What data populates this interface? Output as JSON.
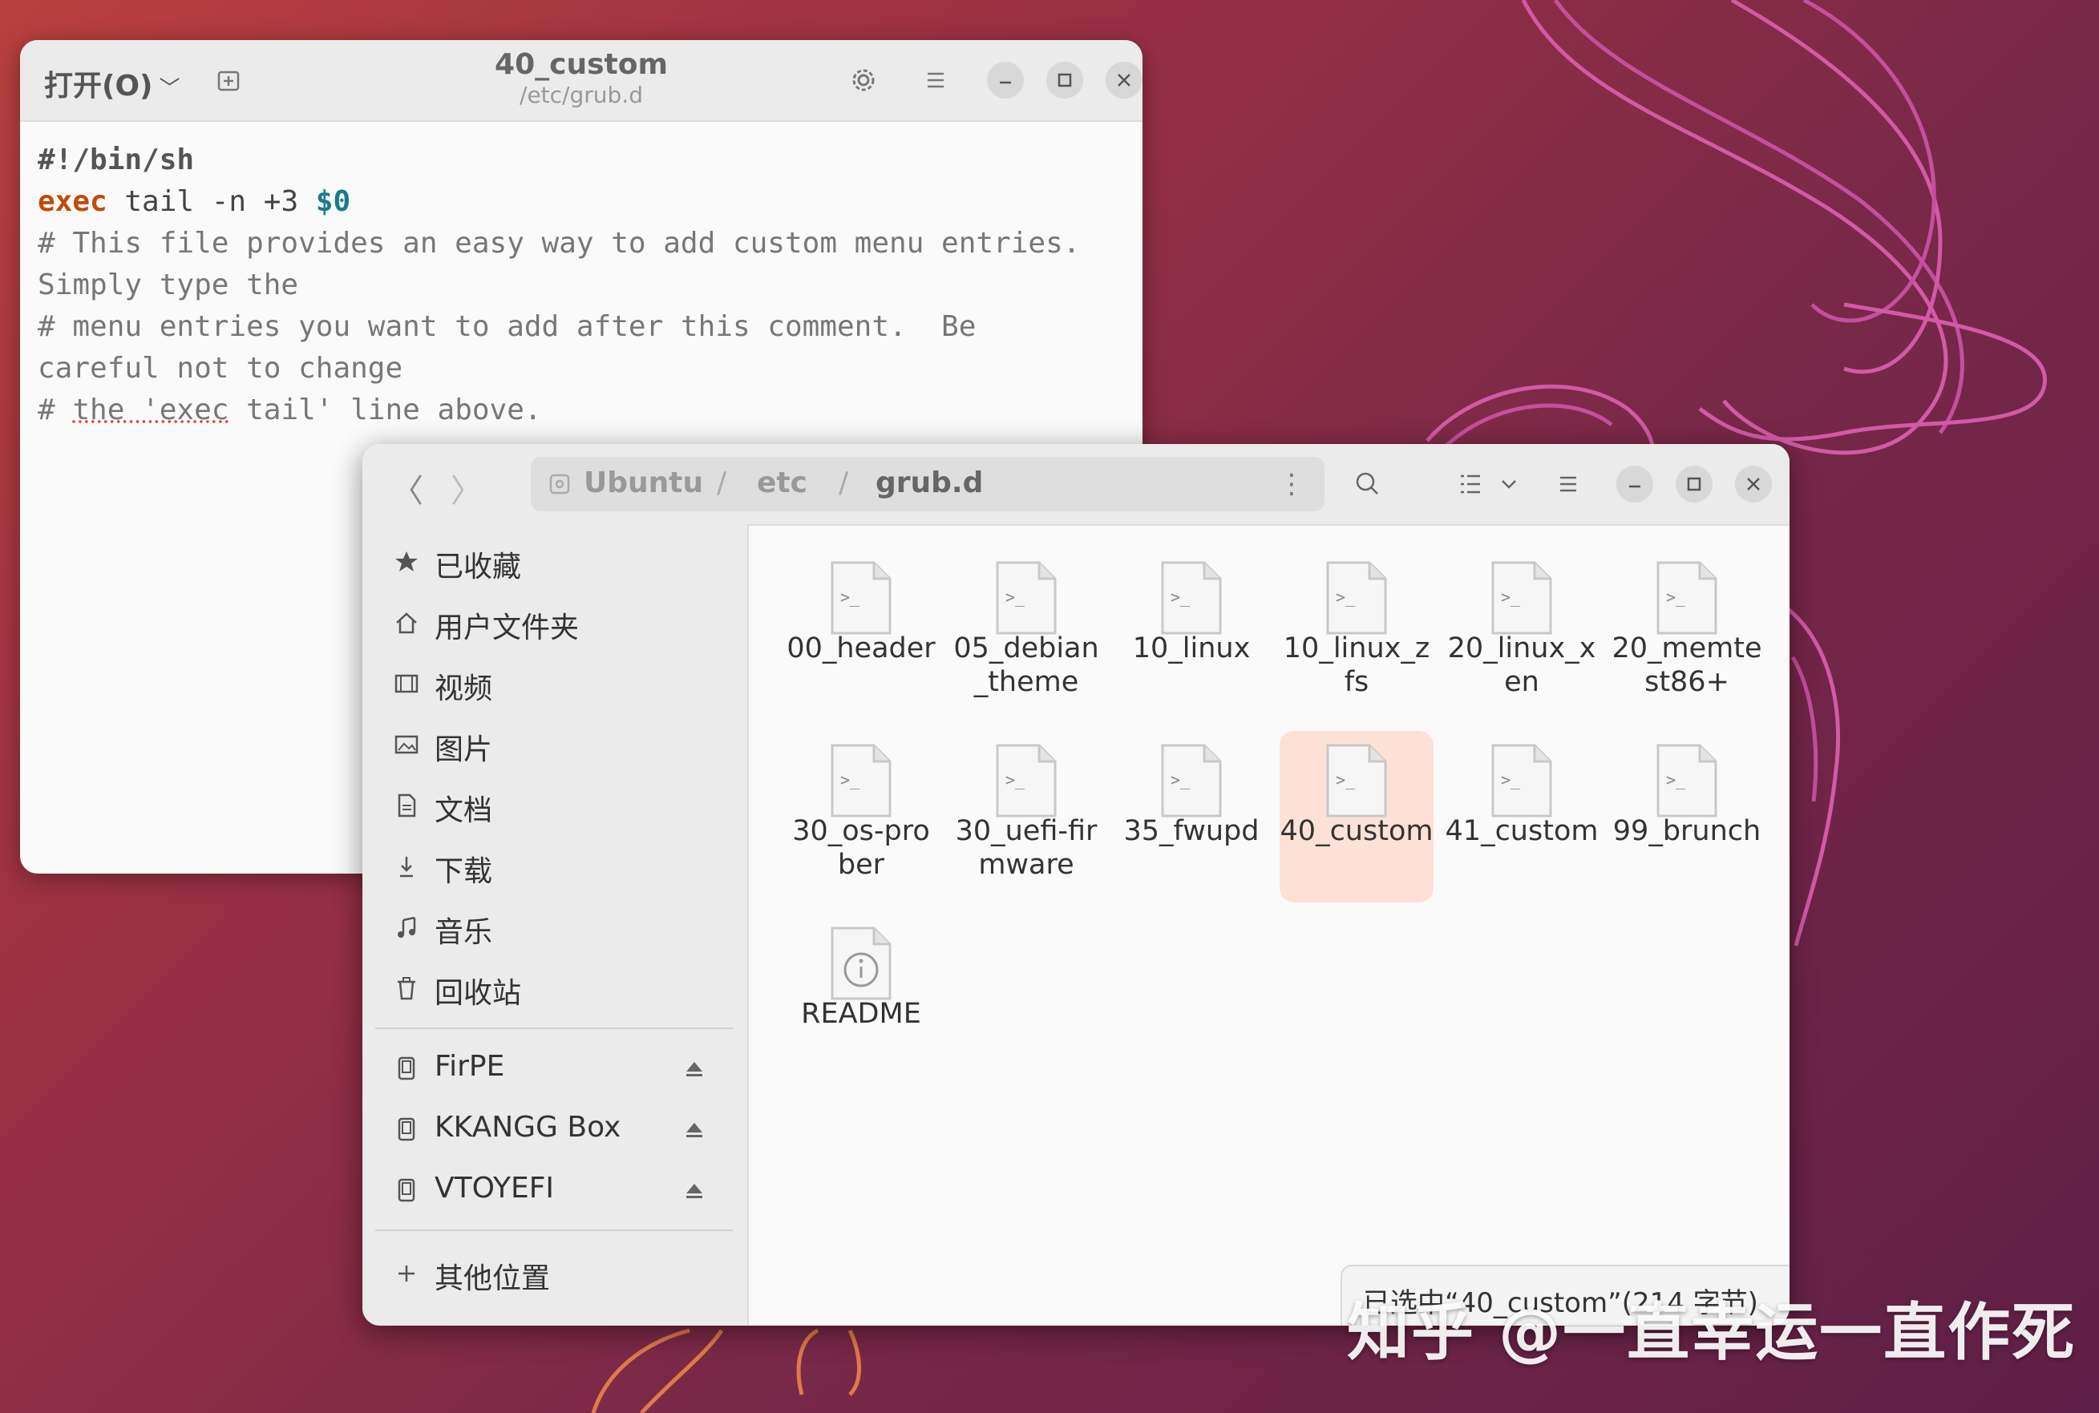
{
  "editor": {
    "open_label": "打开(O)",
    "title": "40_custom",
    "subtitle": "/etc/grub.d",
    "code": {
      "l1": "#!/bin/sh",
      "l2_kw": "exec",
      "l2_mid": " tail -n +3 ",
      "l2_var": "$0",
      "l3": "# This file provides an easy way to add custom menu entries.",
      "l4": "Simply type the",
      "l5": "# menu entries you want to add after this comment.  Be",
      "l6": "careful not to change",
      "l7_a": "# ",
      "l7_b": "the 'exec",
      "l7_c": " tail' line above."
    }
  },
  "files": {
    "path": {
      "root": "Ubuntu",
      "p1": "etc",
      "p2": "grub.d",
      "sep": "/"
    },
    "sidebar": {
      "starred": "已收藏",
      "home": "用户文件夹",
      "videos": "视频",
      "pictures": "图片",
      "documents": "文档",
      "downloads": "下载",
      "music": "音乐",
      "trash": "回收站",
      "drive1": "FirPE",
      "drive2": "KKANGG Box",
      "drive3": "VTOYEFI",
      "other": "其他位置"
    },
    "items": {
      "f1": "00_header",
      "f2": "05_debian_theme",
      "f3": "10_linux",
      "f4": "10_linux_zfs",
      "f5": "20_linux_xen",
      "f6": "20_memtest86+",
      "f7": "30_os-prober",
      "f8": "30_uefi-firmware",
      "f9": "35_fwupd",
      "f10": "40_custom",
      "f11": "41_custom",
      "f12": "99_brunch",
      "f13": "README"
    },
    "selected_item": "40_custom",
    "status": "已选中“40_custom”(214 字节)"
  },
  "watermark": "知乎 @一直幸运一直作死",
  "colors": {
    "accent": "#e95420",
    "selection": "#fde1d6",
    "keyword": "#c14a0c",
    "variable": "#1a7b8a"
  }
}
